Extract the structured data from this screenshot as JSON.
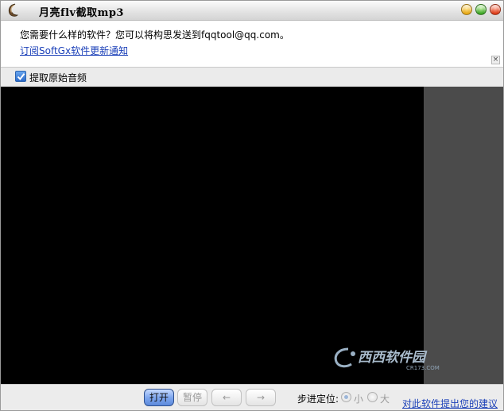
{
  "window": {
    "title": "月亮flv截取mp3"
  },
  "info": {
    "message": "您需要什么样的软件？您可以将构思发送到fqqtool@qq.com。",
    "subscribe_link": "订阅SoftGx软件更新通知",
    "close_glyph": "×"
  },
  "options": {
    "extract_audio_label": "提取原始音频",
    "extract_audio_checked": true
  },
  "watermark": {
    "text": "西西软件园",
    "subtext": "CR173.COM"
  },
  "toolbar": {
    "open_label": "打开",
    "pause_label": "暂停",
    "prev_label": "←",
    "next_label": "→",
    "step_label": "步进定位:",
    "step_small_label": "小",
    "step_big_label": "大",
    "step_selected": "小",
    "feedback_link": "对此软件提出您的建议"
  }
}
